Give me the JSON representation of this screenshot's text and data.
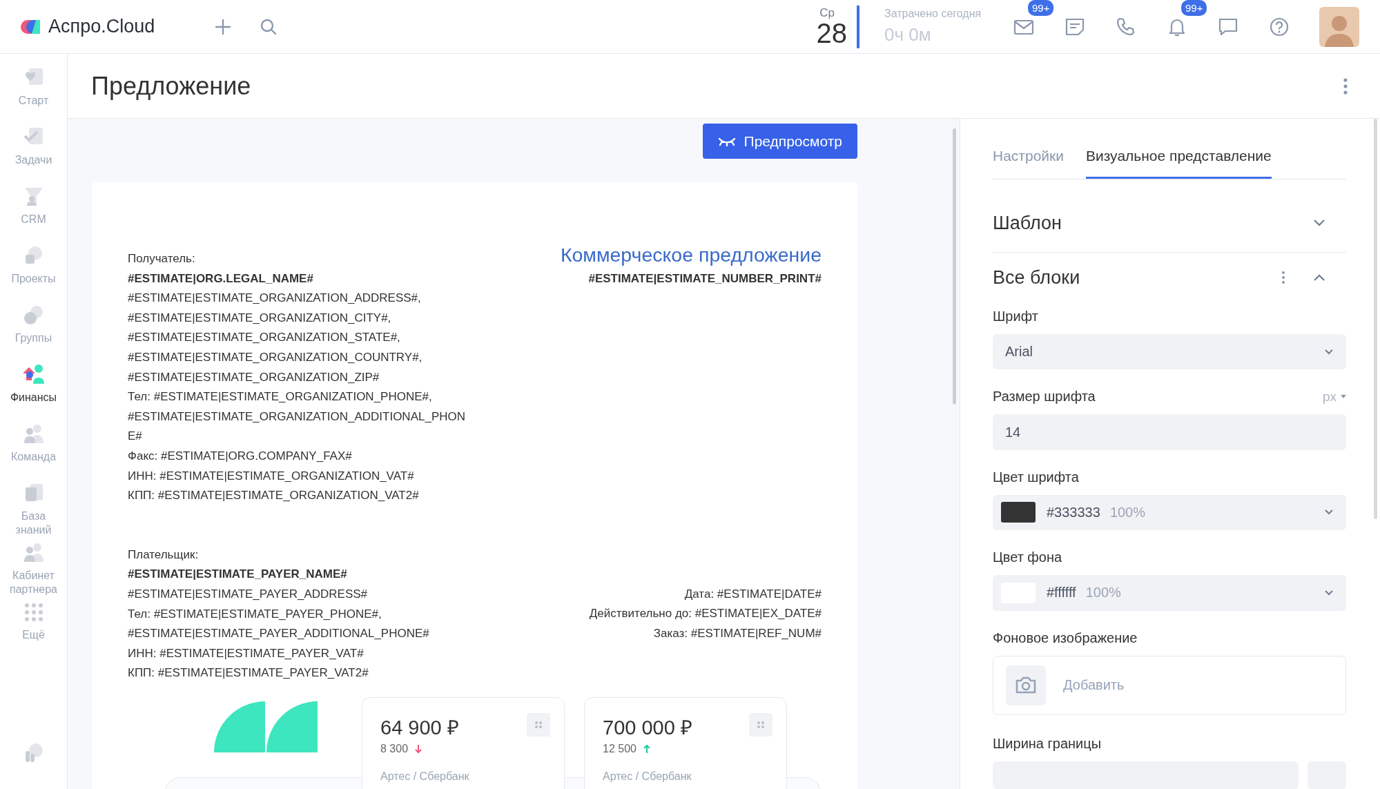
{
  "topbar": {
    "logo": "Аспро.Cloud",
    "day_name": "Ср",
    "day": "28",
    "spent_label": "Затрачено сегодня",
    "spent_value": "0ч 0м",
    "mail_badge": "99+",
    "bell_badge": "99+"
  },
  "sidebar": {
    "items": [
      {
        "label": "Старт",
        "kind": "start",
        "selected": false
      },
      {
        "label": "Задачи",
        "kind": "tasks",
        "selected": false
      },
      {
        "label": "CRM",
        "kind": "crm",
        "selected": false
      },
      {
        "label": "Проекты",
        "kind": "projects",
        "selected": false
      },
      {
        "label": "Группы",
        "kind": "groups",
        "selected": false
      },
      {
        "label": "Финансы",
        "kind": "finance",
        "selected": true
      },
      {
        "label": "Команда",
        "kind": "team",
        "selected": false
      },
      {
        "label": "База знаний",
        "kind": "knowledge",
        "selected": false
      },
      {
        "label": "Кабинет партнера",
        "kind": "team",
        "selected": false
      },
      {
        "label": "Ещё",
        "kind": "more",
        "selected": false
      }
    ]
  },
  "page": {
    "title": "Предложение"
  },
  "preview_button": "Предпросмотр",
  "document": {
    "recipient": [
      {
        "text": "Получатель:",
        "bold": false
      },
      {
        "text": "#ESTIMATE|ORG.LEGAL_NAME#",
        "bold": true
      },
      {
        "text": "#ESTIMATE|ESTIMATE_ORGANIZATION_ADDRESS#,",
        "bold": false
      },
      {
        "text": "#ESTIMATE|ESTIMATE_ORGANIZATION_CITY#,",
        "bold": false
      },
      {
        "text": "#ESTIMATE|ESTIMATE_ORGANIZATION_STATE#,",
        "bold": false
      },
      {
        "text": "#ESTIMATE|ESTIMATE_ORGANIZATION_COUNTRY#,",
        "bold": false
      },
      {
        "text": "#ESTIMATE|ESTIMATE_ORGANIZATION_ZIP#",
        "bold": false
      },
      {
        "text": "Тел: #ESTIMATE|ESTIMATE_ORGANIZATION_PHONE#,",
        "bold": false
      },
      {
        "text": "#ESTIMATE|ESTIMATE_ORGANIZATION_ADDITIONAL_PHON",
        "bold": false
      },
      {
        "text": "E#",
        "bold": false
      },
      {
        "text": "Факс: #ESTIMATE|ORG.COMPANY_FAX#",
        "bold": false
      },
      {
        "text": "ИНН: #ESTIMATE|ESTIMATE_ORGANIZATION_VAT#",
        "bold": false
      },
      {
        "text": "КПП: #ESTIMATE|ESTIMATE_ORGANIZATION_VAT2#",
        "bold": false
      }
    ],
    "title": "Коммерческое предложение",
    "number": "#ESTIMATE|ESTIMATE_NUMBER_PRINT#",
    "payer": [
      {
        "text": "Плательщик:",
        "bold": false
      },
      {
        "text": "#ESTIMATE|ESTIMATE_PAYER_NAME#",
        "bold": true
      },
      {
        "text": "#ESTIMATE|ESTIMATE_PAYER_ADDRESS#",
        "bold": false
      },
      {
        "text": "Тел: #ESTIMATE|ESTIMATE_PAYER_PHONE#,",
        "bold": false
      },
      {
        "text": "#ESTIMATE|ESTIMATE_PAYER_ADDITIONAL_PHONE#",
        "bold": false
      },
      {
        "text": "ИНН: #ESTIMATE|ESTIMATE_PAYER_VAT#",
        "bold": false
      },
      {
        "text": "КПП: #ESTIMATE|ESTIMATE_PAYER_VAT2#",
        "bold": false
      }
    ],
    "dates": [
      "Дата: #ESTIMATE|DATE#",
      "Действительно до: #ESTIMATE|EX_DATE#",
      "Заказ: #ESTIMATE|REF_NUM#"
    ],
    "cards": [
      {
        "amount": "64 900 ₽",
        "delta": "8 300",
        "kind": "decrease",
        "label": "Артес / Сбербанк"
      },
      {
        "amount": "700 000 ₽",
        "delta": "12 500",
        "kind": "increase",
        "label": "Артес / Сбербанк"
      }
    ]
  },
  "panel": {
    "tabs": [
      {
        "label": "Настройки",
        "selected": false
      },
      {
        "label": "Визуальное представление",
        "selected": true
      }
    ],
    "sections": [
      {
        "title": "Шаблон",
        "expanded": false,
        "menu": false
      },
      {
        "title": "Все блоки",
        "expanded": true,
        "menu": true
      }
    ],
    "fields": [
      {
        "kind": "select",
        "label": "Шрифт",
        "value": "Arial"
      },
      {
        "kind": "input",
        "label": "Размер шрифта",
        "unit": "px",
        "value": "14"
      },
      {
        "kind": "color",
        "label": "Цвет шрифта",
        "value": "#333333",
        "opacity": "100%"
      },
      {
        "kind": "color",
        "label": "Цвет фона",
        "value": "#ffffff",
        "opacity": "100%"
      },
      {
        "kind": "image",
        "label": "Фоновое изображение",
        "action": "Добавить"
      },
      {
        "kind": "border",
        "label": "Ширина границы"
      }
    ]
  }
}
